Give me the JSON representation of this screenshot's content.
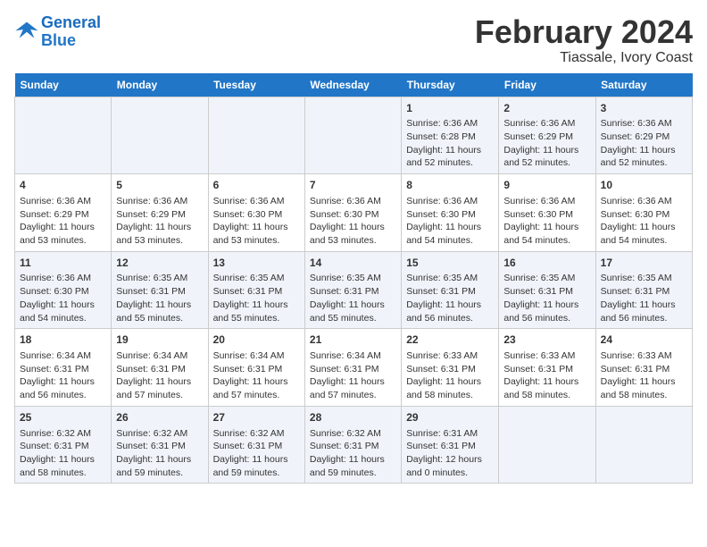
{
  "header": {
    "title": "February 2024",
    "subtitle": "Tiassale, Ivory Coast",
    "logo_general": "General",
    "logo_blue": "Blue"
  },
  "days_of_week": [
    "Sunday",
    "Monday",
    "Tuesday",
    "Wednesday",
    "Thursday",
    "Friday",
    "Saturday"
  ],
  "weeks": [
    [
      {
        "day": "",
        "info": ""
      },
      {
        "day": "",
        "info": ""
      },
      {
        "day": "",
        "info": ""
      },
      {
        "day": "",
        "info": ""
      },
      {
        "day": "1",
        "info": "Sunrise: 6:36 AM\nSunset: 6:28 PM\nDaylight: 11 hours\nand 52 minutes."
      },
      {
        "day": "2",
        "info": "Sunrise: 6:36 AM\nSunset: 6:29 PM\nDaylight: 11 hours\nand 52 minutes."
      },
      {
        "day": "3",
        "info": "Sunrise: 6:36 AM\nSunset: 6:29 PM\nDaylight: 11 hours\nand 52 minutes."
      }
    ],
    [
      {
        "day": "4",
        "info": "Sunrise: 6:36 AM\nSunset: 6:29 PM\nDaylight: 11 hours\nand 53 minutes."
      },
      {
        "day": "5",
        "info": "Sunrise: 6:36 AM\nSunset: 6:29 PM\nDaylight: 11 hours\nand 53 minutes."
      },
      {
        "day": "6",
        "info": "Sunrise: 6:36 AM\nSunset: 6:30 PM\nDaylight: 11 hours\nand 53 minutes."
      },
      {
        "day": "7",
        "info": "Sunrise: 6:36 AM\nSunset: 6:30 PM\nDaylight: 11 hours\nand 53 minutes."
      },
      {
        "day": "8",
        "info": "Sunrise: 6:36 AM\nSunset: 6:30 PM\nDaylight: 11 hours\nand 54 minutes."
      },
      {
        "day": "9",
        "info": "Sunrise: 6:36 AM\nSunset: 6:30 PM\nDaylight: 11 hours\nand 54 minutes."
      },
      {
        "day": "10",
        "info": "Sunrise: 6:36 AM\nSunset: 6:30 PM\nDaylight: 11 hours\nand 54 minutes."
      }
    ],
    [
      {
        "day": "11",
        "info": "Sunrise: 6:36 AM\nSunset: 6:30 PM\nDaylight: 11 hours\nand 54 minutes."
      },
      {
        "day": "12",
        "info": "Sunrise: 6:35 AM\nSunset: 6:31 PM\nDaylight: 11 hours\nand 55 minutes."
      },
      {
        "day": "13",
        "info": "Sunrise: 6:35 AM\nSunset: 6:31 PM\nDaylight: 11 hours\nand 55 minutes."
      },
      {
        "day": "14",
        "info": "Sunrise: 6:35 AM\nSunset: 6:31 PM\nDaylight: 11 hours\nand 55 minutes."
      },
      {
        "day": "15",
        "info": "Sunrise: 6:35 AM\nSunset: 6:31 PM\nDaylight: 11 hours\nand 56 minutes."
      },
      {
        "day": "16",
        "info": "Sunrise: 6:35 AM\nSunset: 6:31 PM\nDaylight: 11 hours\nand 56 minutes."
      },
      {
        "day": "17",
        "info": "Sunrise: 6:35 AM\nSunset: 6:31 PM\nDaylight: 11 hours\nand 56 minutes."
      }
    ],
    [
      {
        "day": "18",
        "info": "Sunrise: 6:34 AM\nSunset: 6:31 PM\nDaylight: 11 hours\nand 56 minutes."
      },
      {
        "day": "19",
        "info": "Sunrise: 6:34 AM\nSunset: 6:31 PM\nDaylight: 11 hours\nand 57 minutes."
      },
      {
        "day": "20",
        "info": "Sunrise: 6:34 AM\nSunset: 6:31 PM\nDaylight: 11 hours\nand 57 minutes."
      },
      {
        "day": "21",
        "info": "Sunrise: 6:34 AM\nSunset: 6:31 PM\nDaylight: 11 hours\nand 57 minutes."
      },
      {
        "day": "22",
        "info": "Sunrise: 6:33 AM\nSunset: 6:31 PM\nDaylight: 11 hours\nand 58 minutes."
      },
      {
        "day": "23",
        "info": "Sunrise: 6:33 AM\nSunset: 6:31 PM\nDaylight: 11 hours\nand 58 minutes."
      },
      {
        "day": "24",
        "info": "Sunrise: 6:33 AM\nSunset: 6:31 PM\nDaylight: 11 hours\nand 58 minutes."
      }
    ],
    [
      {
        "day": "25",
        "info": "Sunrise: 6:32 AM\nSunset: 6:31 PM\nDaylight: 11 hours\nand 58 minutes."
      },
      {
        "day": "26",
        "info": "Sunrise: 6:32 AM\nSunset: 6:31 PM\nDaylight: 11 hours\nand 59 minutes."
      },
      {
        "day": "27",
        "info": "Sunrise: 6:32 AM\nSunset: 6:31 PM\nDaylight: 11 hours\nand 59 minutes."
      },
      {
        "day": "28",
        "info": "Sunrise: 6:32 AM\nSunset: 6:31 PM\nDaylight: 11 hours\nand 59 minutes."
      },
      {
        "day": "29",
        "info": "Sunrise: 6:31 AM\nSunset: 6:31 PM\nDaylight: 12 hours\nand 0 minutes."
      },
      {
        "day": "",
        "info": ""
      },
      {
        "day": "",
        "info": ""
      }
    ]
  ]
}
